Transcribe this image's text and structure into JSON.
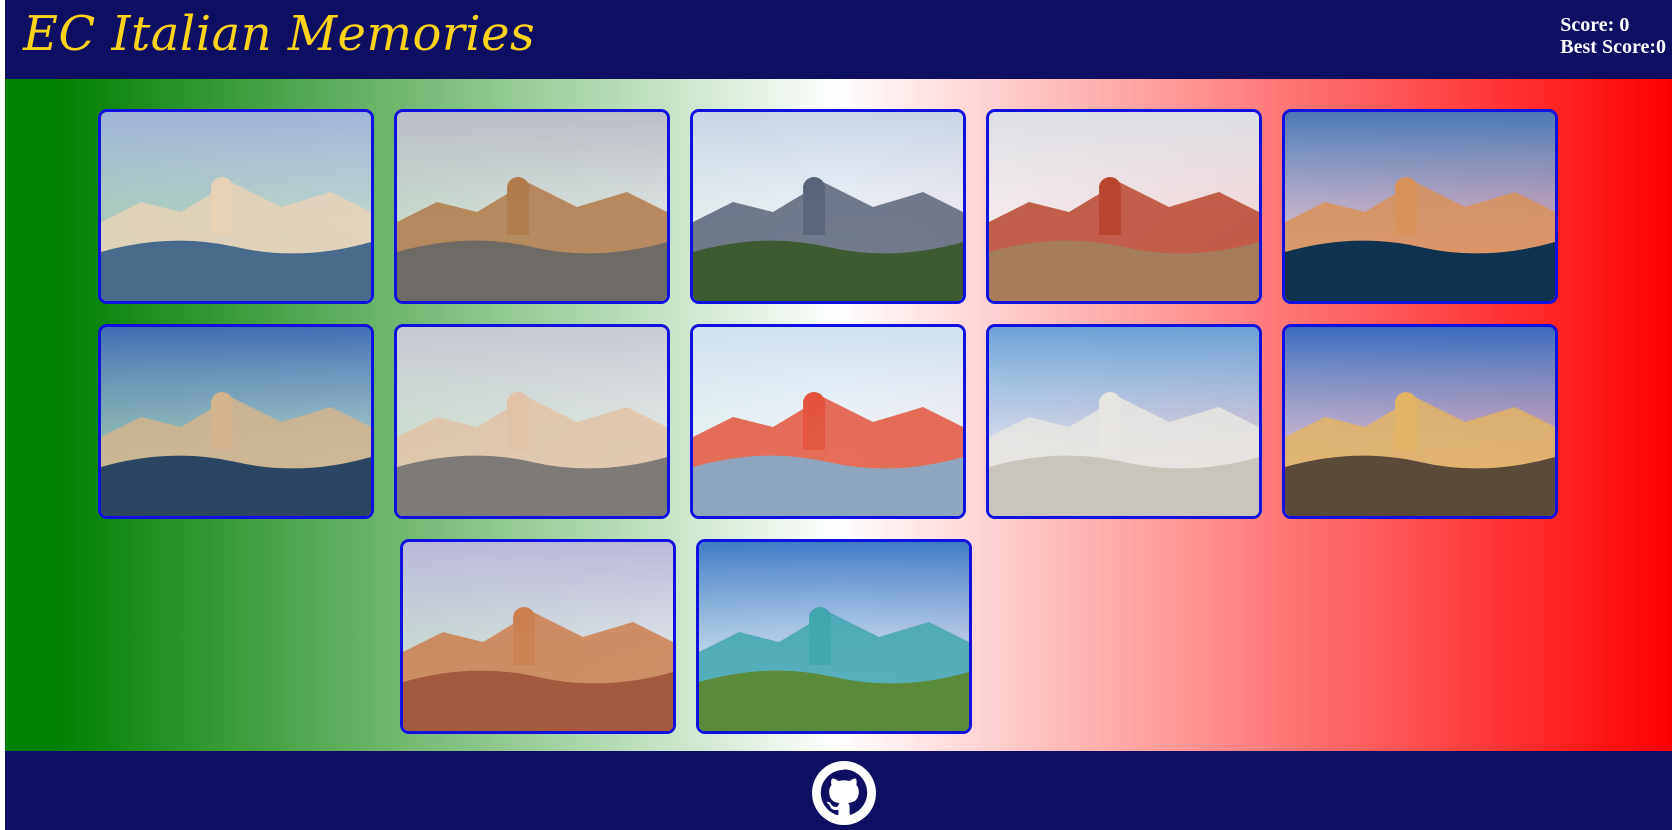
{
  "header": {
    "title": "EC Italian Memories",
    "score_label": "Score: 0",
    "best_score_label": "Best Score:0"
  },
  "colors": {
    "nav": "#0e0e62",
    "title": "#ffd31a",
    "card_border": "#1010e0",
    "flag_green": "#008000",
    "flag_red": "#ff0000"
  },
  "cards": [
    {
      "scene": "venice-grand-canal",
      "sky": "#9fb3d6",
      "ground": "#4a6a8c",
      "accent": "#e8d2b8"
    },
    {
      "scene": "rome-colosseum",
      "sky": "#b9bcc6",
      "ground": "#6e6a66",
      "accent": "#b07a4a"
    },
    {
      "scene": "naples-vesuvius",
      "sky": "#c8d5e6",
      "ground": "#3e5a32",
      "accent": "#5a6478"
    },
    {
      "scene": "florence-duomo",
      "sky": "#dcdfe4",
      "ground": "#a67c5a",
      "accent": "#b9462e"
    },
    {
      "scene": "cinque-terre-manarola",
      "sky": "#4a78b8",
      "ground": "#10324f",
      "accent": "#d9925a"
    },
    {
      "scene": "bari-seafront",
      "sky": "#3f6fb6",
      "ground": "#2c4560",
      "accent": "#d2b48e"
    },
    {
      "scene": "milan-cathedral",
      "sky": "#c8c9d4",
      "ground": "#7d7a78",
      "accent": "#e0c3a8"
    },
    {
      "scene": "colorful-houses",
      "sky": "#cfe0ef",
      "ground": "#8ea7bf",
      "accent": "#e2553c"
    },
    {
      "scene": "alberobello-trulli",
      "sky": "#6aa3d8",
      "ground": "#c9c4bc",
      "accent": "#e8e6e1"
    },
    {
      "scene": "catania-cathedral",
      "sky": "#3a6cc0",
      "ground": "#5a4a3a",
      "accent": "#e2b464"
    },
    {
      "scene": "bologna-towers",
      "sky": "#b9b8d8",
      "ground": "#a45a3c",
      "accent": "#cc7f4e"
    },
    {
      "scene": "lake-lugano",
      "sky": "#3e7cc8",
      "ground": "#5a8a3a",
      "accent": "#3fa6b0"
    }
  ],
  "footer": {
    "icon": "github-icon"
  }
}
